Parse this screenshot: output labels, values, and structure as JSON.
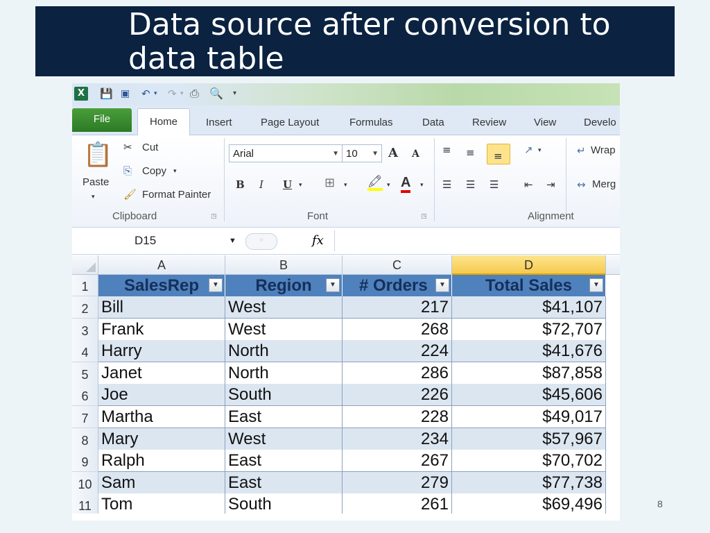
{
  "slide": {
    "title": "Data source after conversion to data table",
    "page_number": "8"
  },
  "excel": {
    "tabs": [
      "File",
      "Home",
      "Insert",
      "Page Layout",
      "Formulas",
      "Data",
      "Review",
      "View",
      "Develo"
    ],
    "clipboard": {
      "paste": "Paste",
      "cut": "Cut",
      "copy": "Copy",
      "format_painter": "Format Painter",
      "group_label": "Clipboard"
    },
    "font": {
      "name": "Arial",
      "size": "10",
      "group_label": "Font",
      "bold": "B",
      "italic": "I",
      "underline": "U",
      "grow": "A",
      "shrink": "A",
      "font_color_glyph": "A"
    },
    "alignment": {
      "wrap": "Wrap",
      "merge": "Merg",
      "group_label": "Alignment"
    },
    "name_box": "D15",
    "fx_label": "fx",
    "columns": [
      "A",
      "B",
      "C",
      "D"
    ],
    "header_row_number": "1",
    "table_headers": [
      "SalesRep",
      "Region",
      "# Orders",
      "Total Sales"
    ],
    "rows": [
      {
        "num": "2",
        "rep": "Bill",
        "region": "West",
        "orders": "217",
        "sales": "$41,107"
      },
      {
        "num": "3",
        "rep": "Frank",
        "region": "West",
        "orders": "268",
        "sales": "$72,707"
      },
      {
        "num": "4",
        "rep": "Harry",
        "region": "North",
        "orders": "224",
        "sales": "$41,676"
      },
      {
        "num": "5",
        "rep": "Janet",
        "region": "North",
        "orders": "286",
        "sales": "$87,858"
      },
      {
        "num": "6",
        "rep": "Joe",
        "region": "South",
        "orders": "226",
        "sales": "$45,606"
      },
      {
        "num": "7",
        "rep": "Martha",
        "region": "East",
        "orders": "228",
        "sales": "$49,017"
      },
      {
        "num": "8",
        "rep": "Mary",
        "region": "West",
        "orders": "234",
        "sales": "$57,967"
      },
      {
        "num": "9",
        "rep": "Ralph",
        "region": "East",
        "orders": "267",
        "sales": "$70,702"
      },
      {
        "num": "10",
        "rep": "Sam",
        "region": "East",
        "orders": "279",
        "sales": "$77,738"
      },
      {
        "num": "11",
        "rep": "Tom",
        "region": "South",
        "orders": "261",
        "sales": "$69,496"
      }
    ],
    "colors": {
      "header_fill": "#4f81bd",
      "band_fill": "#dce6f1",
      "selected_column": "#f6c94d"
    }
  }
}
